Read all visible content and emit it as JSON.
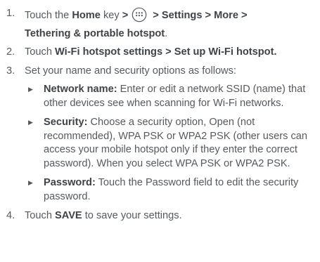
{
  "steps": [
    {
      "num": "1.",
      "pre": "Touch the ",
      "home": "Home",
      "key_text": " key ",
      "arrow1": ">",
      "arrow2": " > ",
      "path1": "Settings > More >",
      "path2": "Tethering & portable hotspot",
      "end": "."
    },
    {
      "num": "2.",
      "pre": "Touch ",
      "bold": "Wi-Fi hotspot settings > Set up Wi-Fi hotspot."
    },
    {
      "num": "3.",
      "text": "Set your name and security options as follows:",
      "bullets": [
        {
          "label": "Network name:",
          "text": " Enter or edit a network SSID (name) that other devices see when scanning for Wi-Fi networks."
        },
        {
          "label": "Security:",
          "text": " Choose a security option, Open (not recommended), WPA PSK or WPA2 PSK (other users can access your mobile hotspot only if they enter the correct password). When you select WPA PSK or WPA2 PSK."
        },
        {
          "label": "Password:",
          "text": " Touch the Password field to edit the security password."
        }
      ]
    },
    {
      "num": "4.",
      "pre": "Touch ",
      "bold": "SAVE",
      "post": " to save your settings."
    }
  ],
  "icons": {
    "apps": "apps-grid-icon",
    "bullet": "triangle-bullet-icon"
  },
  "colors": {
    "text": "#555a5f",
    "bold_text": "#3e4348"
  }
}
